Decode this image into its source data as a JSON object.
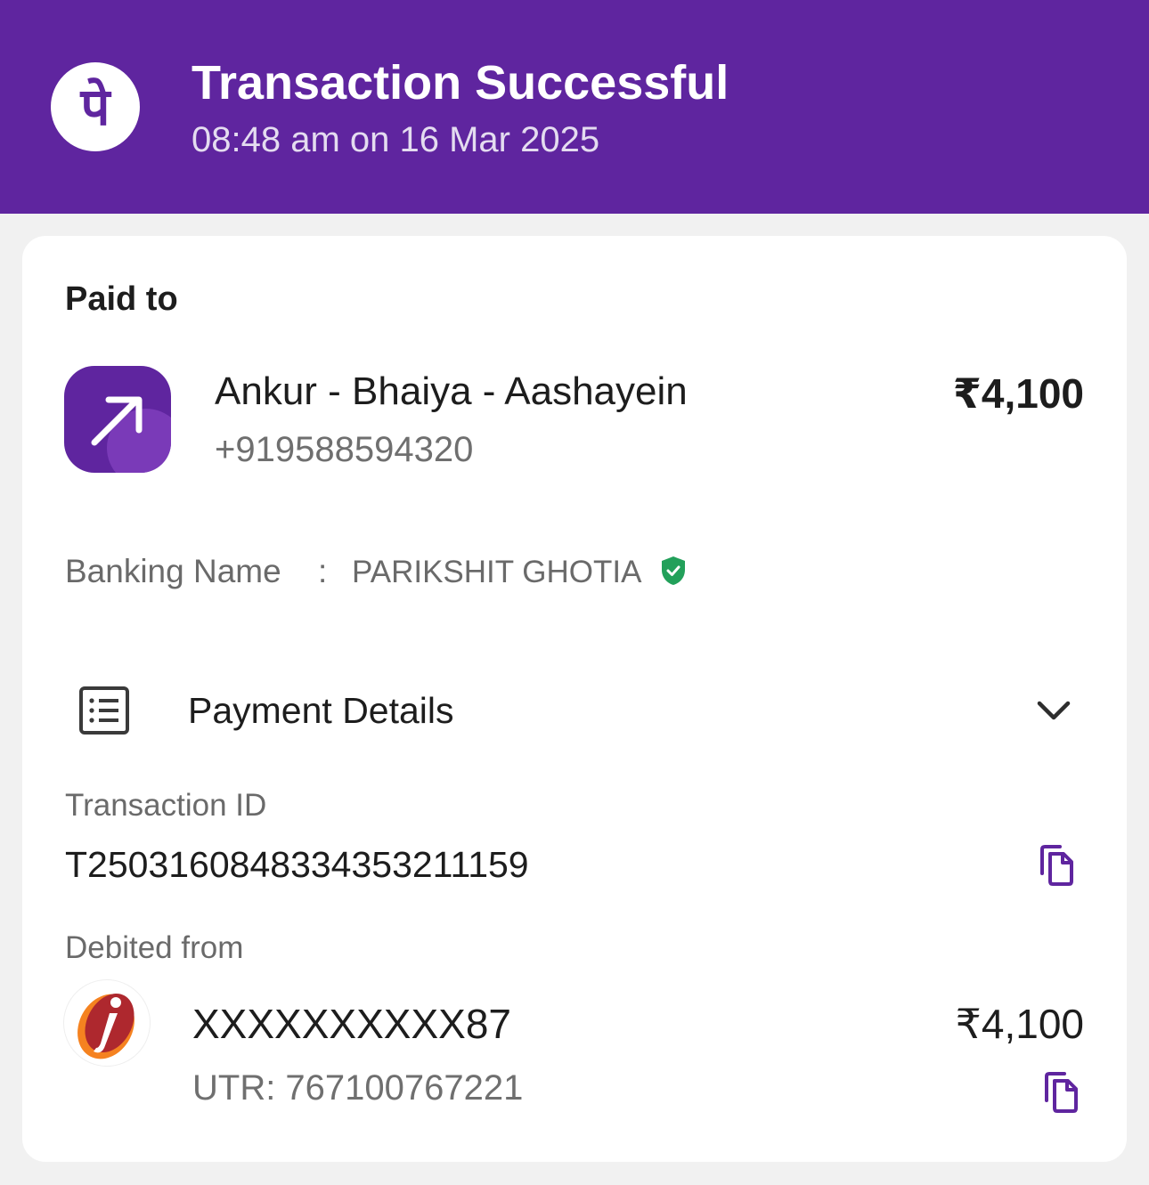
{
  "header": {
    "logo_glyph": "पे",
    "title": "Transaction Successful",
    "timestamp": "08:48 am on 16 Mar 2025",
    "background_color": "#5f259f"
  },
  "paid_to": {
    "label": "Paid to",
    "icon": "arrow-up-right-icon",
    "name": "Ankur - Bhaiya - Aashayein",
    "phone": "+919588594320",
    "amount": "₹4,100"
  },
  "banking_name": {
    "label": "Banking Name",
    "separator": ":",
    "value": "PARIKSHIT GHOTIA",
    "verified_icon": "verified-shield-icon",
    "verified_color": "#22a05a"
  },
  "payment_details": {
    "icon": "receipt-list-icon",
    "title": "Payment Details",
    "toggle_icon": "chevron-down-icon",
    "transaction_id_label": "Transaction ID",
    "transaction_id": "T2503160848334353211159",
    "debited_from_label": "Debited from",
    "bank_logo": "icici-bank-logo",
    "account_number": "XXXXXXXXXX87",
    "debited_amount": "₹4,100",
    "utr": "UTR: 767100767221",
    "copy_icon": "copy-icon"
  }
}
